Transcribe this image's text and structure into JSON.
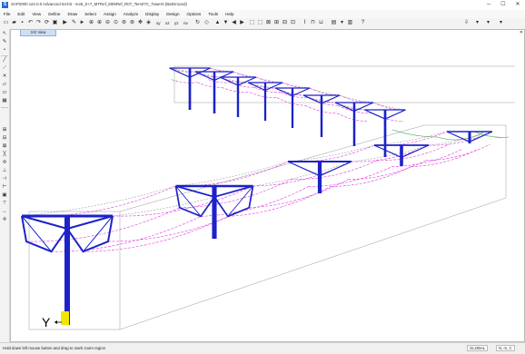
{
  "window": {
    "app_icon_letter": "S",
    "title": "SAP2000 v24.0.0 Advanced 64-bit - rev6_0+7_MTRef_M05Ref_R07_Tem07C_Tower0 (BatGround)",
    "minimize": "─",
    "maximize": "☐",
    "close": "✕"
  },
  "menu": [
    "File",
    "Edit",
    "View",
    "Define",
    "Draw",
    "Select",
    "Assign",
    "Analyze",
    "Display",
    "Design",
    "Options",
    "Tools",
    "Help"
  ],
  "toolbar": {
    "view_labels": [
      "xy",
      "xz",
      "yz",
      "nv"
    ],
    "icons": [
      "new-icon",
      "open-icon",
      "save-icon",
      "undo-icon",
      "redo-icon",
      "refresh-icon",
      "lock-icon",
      "run-icon",
      "zoom-in-icon",
      "zoom-out-icon",
      "pan-icon",
      "3d-view-icon"
    ]
  },
  "view": {
    "tab_label": "3-D View",
    "close_glyph": "✕"
  },
  "axis": {
    "label": "Y"
  },
  "statusbar": {
    "message": "Hold down left mouse button and drag to mark zoom region",
    "coord_system": "GLOBAL",
    "units": "N, m, C"
  },
  "colors": {
    "tower": "#1c22c8",
    "cable": "#e23ae0",
    "ground_wire": "#888888",
    "guide": "#9a9a9a",
    "support_marker": "#f2e600",
    "green_cable": "#3a9a3a"
  }
}
